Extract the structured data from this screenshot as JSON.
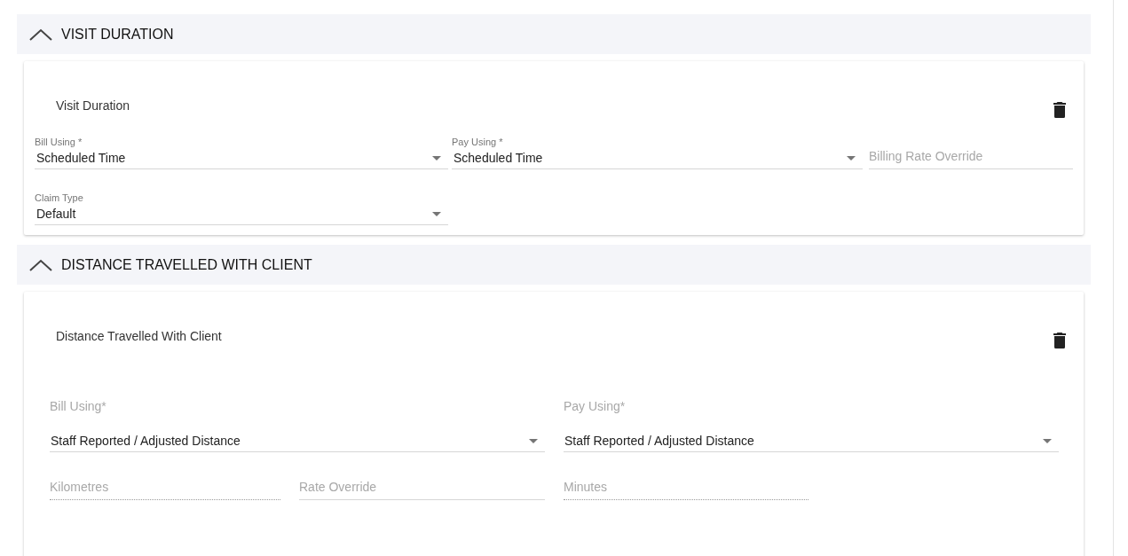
{
  "sections": [
    {
      "kind": "compact",
      "title": "VISIT DURATION",
      "expanded": true,
      "card_title": "Visit Duration",
      "fields": [
        {
          "kind": "select",
          "label": "Bill Using *",
          "value": "Scheduled Time",
          "disabled": false
        },
        {
          "kind": "select",
          "label": "Pay Using *",
          "value": "Scheduled Time",
          "disabled": false
        },
        {
          "kind": "text",
          "placeholder": "Billing Rate Override",
          "disabled": false
        },
        {
          "kind": "select",
          "label": "Claim Type",
          "value": "Default",
          "disabled": false
        }
      ]
    },
    {
      "kind": "spaced",
      "title": "DISTANCE TRAVELLED WITH CLIENT",
      "expanded": true,
      "card_title": "Distance Travelled With Client",
      "fields": [
        {
          "kind": "select",
          "label": "Bill Using*",
          "value": "Staff Reported / Adjusted Distance",
          "disabled": false
        },
        {
          "kind": "select",
          "label": "Pay Using*",
          "value": "Staff Reported / Adjusted Distance",
          "disabled": false
        },
        {
          "kind": "text",
          "placeholder": "Kilometres",
          "disabled": true
        },
        {
          "kind": "text",
          "placeholder": "Rate Override",
          "disabled": false
        },
        {
          "kind": "text",
          "placeholder": "Minutes",
          "disabled": true
        }
      ]
    }
  ]
}
